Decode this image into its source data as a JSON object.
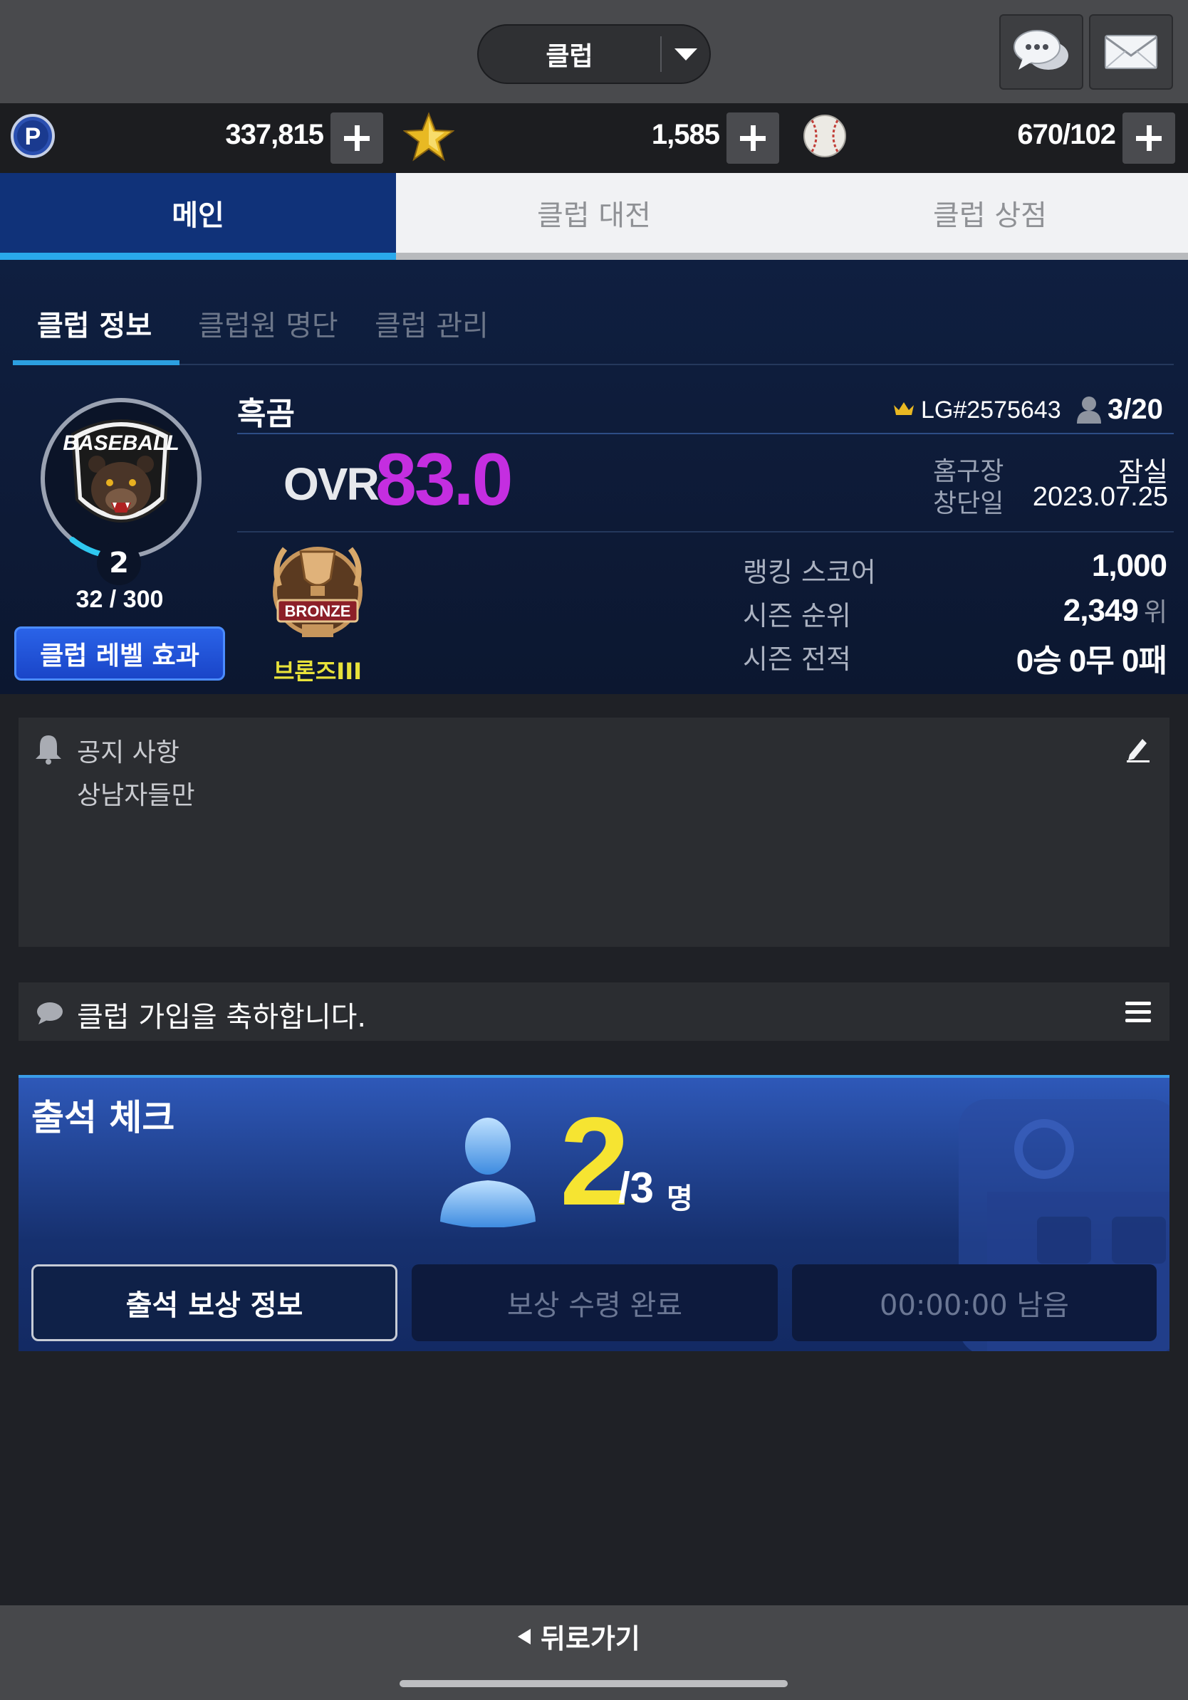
{
  "header": {
    "club_select_label": "클럽",
    "chat_icon": "chat-bubbles-icon",
    "mail_icon": "envelope-icon"
  },
  "currency": {
    "points": "337,815",
    "stars": "1,585",
    "balls": "670/102"
  },
  "main_tabs": [
    {
      "label": "메인",
      "active": true
    },
    {
      "label": "클럽 대전",
      "active": false
    },
    {
      "label": "클럽 상점",
      "active": false
    }
  ],
  "sub_tabs": [
    {
      "label": "클럽 정보",
      "active": true
    },
    {
      "label": "클럽원 명단",
      "active": false
    },
    {
      "label": "클럽 관리",
      "active": false
    }
  ],
  "club": {
    "name": "흑곰",
    "code": "LG#2575643",
    "members": "3/20",
    "emblem_text": "BASEBALL",
    "level": "2",
    "exp": "32 / 300",
    "exp_fraction": 0.107,
    "level_button": "클럽 레벨 효과",
    "ovr_label": "OVR",
    "ovr_value": "83.0",
    "home_label": "홈구장",
    "home_value": "잠실",
    "founded_label": "창단일",
    "founded_value": "2023.07.25",
    "tier_badge_text": "BRONZE",
    "tier_name": "브론즈III",
    "ranking_score_label": "랭킹 스코어",
    "ranking_score": "1,000",
    "season_rank_label": "시즌 순위",
    "season_rank": "2,349",
    "season_rank_unit": "위",
    "season_record_label": "시즌 전적",
    "season_record": "0승 0무 0패"
  },
  "notice": {
    "title": "공지 사항",
    "body": "상남자들만"
  },
  "chat": {
    "message": "클럽 가입을 축하합니다."
  },
  "attendance": {
    "title": "출석 체크",
    "count": "2",
    "total": "/3",
    "unit": "명",
    "reward_info_button": "출석 보상 정보",
    "reward_claimed_button": "보상 수령 완료",
    "timer_button": "00:00:00 남음"
  },
  "footer": {
    "back_label": "뒤로가기"
  },
  "colors": {
    "accent_blue": "#103279",
    "tab_underline": "#29a9ec",
    "ovr_purple": "#c42ee0",
    "tier_yellow": "#e8e23a",
    "attendance_yellow": "#f6e431"
  }
}
